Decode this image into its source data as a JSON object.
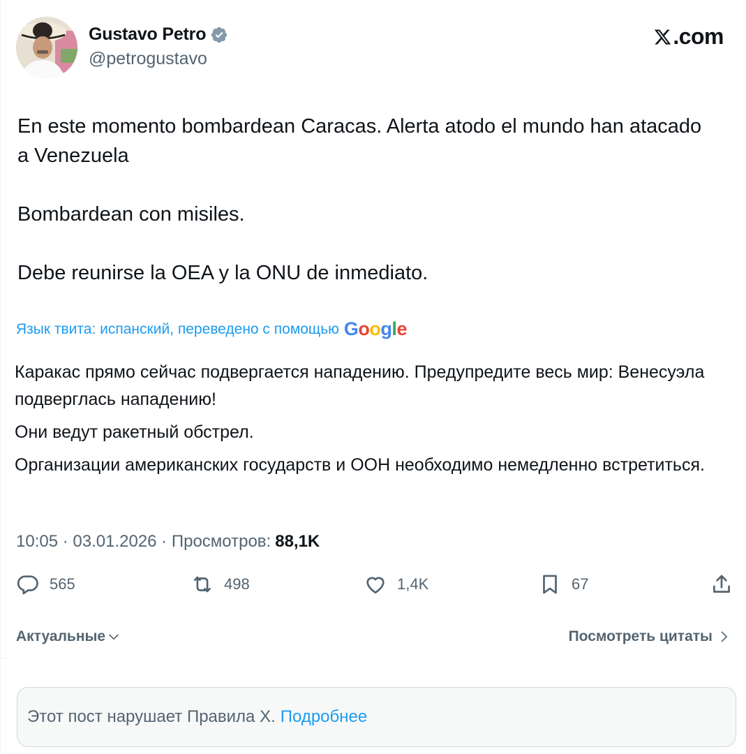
{
  "author": {
    "display_name": "Gustavo Petro",
    "handle": "@petrogustavo",
    "verified": true
  },
  "site_label": ".com",
  "tweet": {
    "paragraphs": [
      "En este momento bombardean Caracas. Alerta atodo el mundo han atacado a Venezuela",
      "Bombardean con misiles.",
      "Debe reunirse la OEA y la ONU de inmediato."
    ]
  },
  "translation": {
    "note": "Язык твита: испанский, переведено с помощью",
    "provider": "Google",
    "paragraphs": [
      "Каракас прямо сейчас подвергается нападению. Предупредите весь мир: Венесуэла подверглась нападению!",
      "Они ведут ракетный обстрел.",
      "Организации американских государств и ООН необходимо немедленно встретиться."
    ]
  },
  "meta": {
    "time": "10:05",
    "date": "03.01.2026",
    "views_label": "Просмотров:",
    "views_count": "88,1K"
  },
  "actions": {
    "replies": "565",
    "reposts": "498",
    "likes": "1,4K",
    "bookmarks": "67"
  },
  "replies_sort": {
    "label": "Актуальные"
  },
  "quotes_link": "Посмотреть цитаты",
  "notice": {
    "text": "Этот пост нарушает Правила X.",
    "link": "Подробнее"
  },
  "colors": {
    "text_primary": "#0f1419",
    "text_secondary": "#536471",
    "accent": "#1d9bf0",
    "verified_badge": "#829aab"
  },
  "icons": [
    "verified-badge-icon",
    "x-logo-icon",
    "reply-icon",
    "repost-icon",
    "like-icon",
    "bookmark-icon",
    "share-icon",
    "chevron-down-icon",
    "chevron-right-icon"
  ]
}
